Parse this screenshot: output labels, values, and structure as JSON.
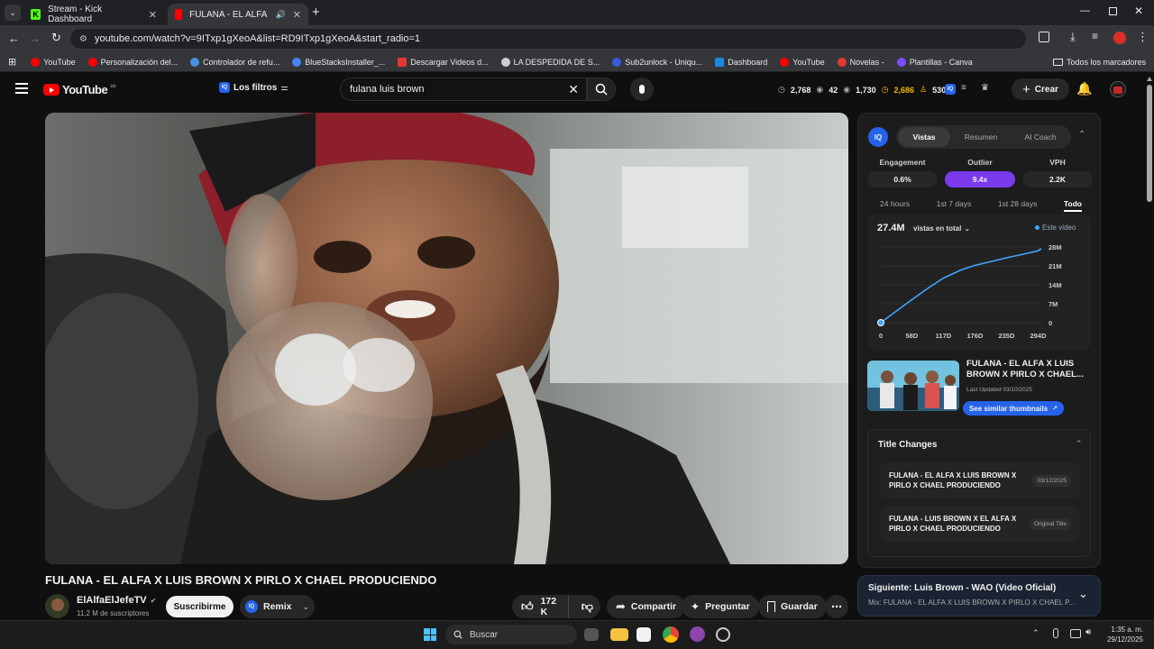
{
  "browser": {
    "tabs": [
      {
        "title": "Stream - Kick Dashboard",
        "active": false
      },
      {
        "title": "FULANA - EL ALFA X LUIS B",
        "active": true
      }
    ],
    "url": "youtube.com/watch?v=9ITxp1gXeoA&list=RD9ITxp1gXeoA&start_radio=1",
    "bookmarks": [
      {
        "label": "YouTube",
        "color": "#ff0000"
      },
      {
        "label": "Personalización del...",
        "color": "#ff0000"
      },
      {
        "label": "Controlador de refu...",
        "color": "#4a90e2"
      },
      {
        "label": "BlueStacksInstaller_...",
        "color": "#4285f4"
      },
      {
        "label": "Descargar Videos d...",
        "color": "#e53935"
      },
      {
        "label": "LA DESPEDIDA DE S...",
        "color": "#cccccc"
      },
      {
        "label": "Sub2unlock - Uniqu...",
        "color": "#3b5bdb"
      },
      {
        "label": "Dashboard",
        "color": "#1e88e5"
      },
      {
        "label": "YouTube",
        "color": "#ff0000"
      },
      {
        "label": "Novelas -",
        "color": "#e53935"
      },
      {
        "label": "Plantillas - Canva",
        "color": "#7c4dff"
      }
    ],
    "all_bookmarks": "Todos los marcadores"
  },
  "yt": {
    "logo": "YouTube",
    "filters_label": "Los filtros",
    "search_value": "fulana luis brown",
    "stats": [
      "2,768",
      "42",
      "1,730",
      "2,686",
      "530"
    ],
    "create_label": "Crear"
  },
  "panel": {
    "tabs": [
      "Vistas",
      "Resumen",
      "AI Coach"
    ],
    "metric_labels": [
      "Engagement",
      "Outlier",
      "VPH"
    ],
    "metric_values": [
      "0.6%",
      "9.4x",
      "2.2K"
    ],
    "ranges": [
      "24 hours",
      "1st 7 days",
      "1st 28 days",
      "Todo"
    ],
    "total_views": "27.4M",
    "views_dropdown": "vistas en total",
    "legend": "Este video",
    "y_ticks": [
      "28M",
      "21M",
      "14M",
      "7M",
      "0"
    ],
    "x_ticks": [
      "0",
      "58D",
      "117D",
      "176D",
      "235D",
      "294D"
    ],
    "thumb_title": "FULANA - EL ALFA X LUIS BROWN X PIRLO X CHAEL...",
    "last_updated": "Last Updated 03/10/2025",
    "similar_btn": "See similar thumbnails",
    "title_changes_heading": "Title Changes",
    "title_changes": [
      {
        "title": "FULANA - EL ALFA X LUIS BROWN X PIRLO X CHAEL PRODUCIENDO",
        "tag": "03/12/2025"
      },
      {
        "title": "FULANA - LUIS BROWN X EL ALFA X PIRLO X CHAEL PRODUCIENDO",
        "tag": "Original Title"
      }
    ]
  },
  "chart_data": {
    "type": "line",
    "xlabel": "",
    "ylabel": "",
    "x_ticks": [
      "0",
      "58D",
      "117D",
      "176D",
      "235D",
      "294D"
    ],
    "ylim": [
      0,
      28
    ],
    "y_unit": "M",
    "series": [
      {
        "name": "Este video",
        "x": [
          0,
          20,
          58,
          90,
          117,
          150,
          176,
          210,
          235,
          270,
          294,
          300
        ],
        "y": [
          0,
          3.0,
          8.5,
          13.0,
          16.5,
          19.5,
          21.2,
          22.8,
          24.0,
          25.5,
          26.6,
          27.4
        ]
      }
    ]
  },
  "video": {
    "title": "FULANA - EL ALFA X LUIS BROWN X PIRLO X CHAEL PRODUCIENDO",
    "channel": "ElAlfaElJefeTV",
    "subs": "11,2 M de suscriptores",
    "subscribe": "Suscribirme",
    "remix": "Remix",
    "likes": "172 K",
    "share": "Compartir",
    "ask": "Preguntar",
    "save": "Guardar"
  },
  "next": {
    "label": "Siguiente: Luis Brown - WAO (Video Oficial)",
    "mix": "Mix: FULANA - EL ALFA X LUIS BROWN X PIRLO X CHAEL P..."
  },
  "taskbar": {
    "search": "Buscar",
    "time": "1:35 a. m.",
    "date": "29/12/2025"
  }
}
